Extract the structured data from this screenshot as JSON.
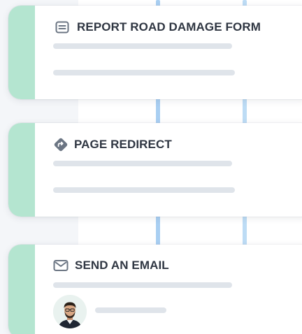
{
  "workflow": {
    "steps": [
      {
        "title": "REPORT ROAD DAMAGE FORM",
        "icon": "form-icon"
      },
      {
        "title": "PAGE REDIRECT",
        "icon": "redirect-arrow-icon"
      },
      {
        "title": "SEND AN EMAIL",
        "icon": "mail-icon"
      }
    ]
  },
  "colors": {
    "accent": "#b4e5d0",
    "connector": "#a9cff2",
    "text": "#2f3642",
    "placeholder": "#dfe4ea"
  }
}
